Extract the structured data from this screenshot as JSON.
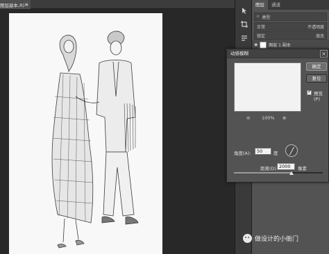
{
  "document": {
    "tab_title": "图层副本,R) *",
    "close_glyph": "×"
  },
  "panels": {
    "tabs": [
      "图层",
      "通道"
    ],
    "search_placeholder": "类型",
    "blend_mode": "正常",
    "opacity_label": "不透明度",
    "lock_label": "锁定",
    "fill_label": "填充",
    "layer_name": "图层 1 副本"
  },
  "tool_icons": [
    "arrow-icon",
    "crop-icon",
    "paragraph-icon",
    "adjust-icon",
    "brush-icon"
  ],
  "dialog": {
    "title": "动感模糊",
    "close_glyph": "×",
    "ok_label": "确定",
    "reset_label": "复位",
    "preview_label": "预览(P)",
    "preview_checked": true,
    "zoom_out_glyph": "⊖",
    "zoom_in_glyph": "⊕",
    "zoom_level": "100%",
    "angle_label": "角度(A):",
    "angle_value": "50",
    "angle_unit": "度",
    "distance_label": "距离(D):",
    "distance_value": "2000",
    "distance_unit": "像素",
    "distance_slider_fraction": 0.65
  },
  "watermark": {
    "text": "做设计的小衙门"
  }
}
